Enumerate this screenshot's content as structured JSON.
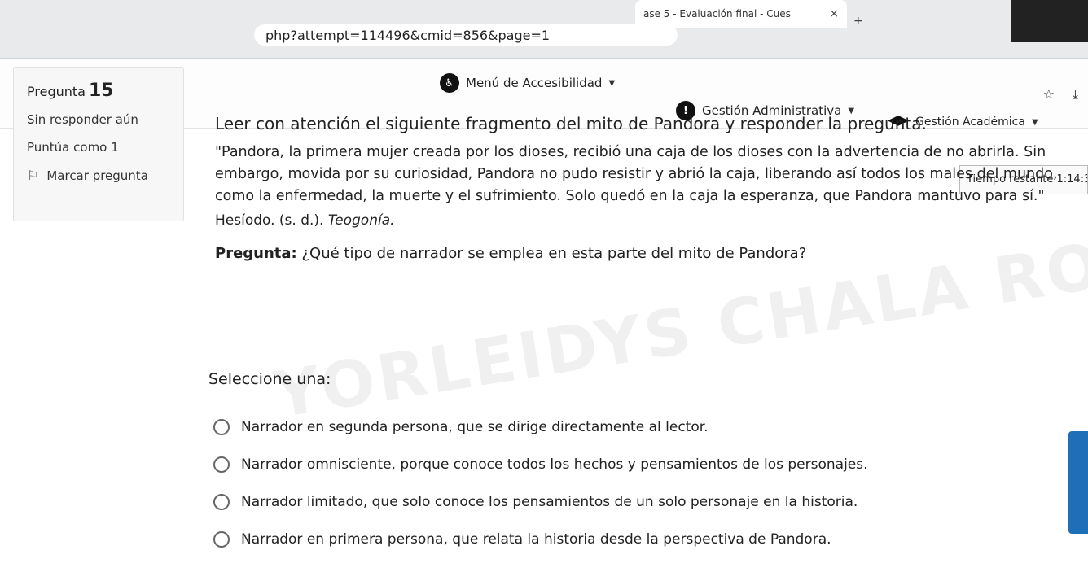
{
  "browser": {
    "tab_title": "ase 5 - Evaluación final - Cues",
    "tab_close": "×",
    "new_tab": "+",
    "url": "php?attempt=114496&cmid=856&page=1"
  },
  "navbar": {
    "accessibility_menu": "Menú de Accesibilidad",
    "admin_menu": "Gestión Administrativa",
    "academic_menu": "Gestión Académica"
  },
  "question_info": {
    "label": "Pregunta",
    "number": "15",
    "status": "Sin responder aún",
    "score": "Puntúa como 1",
    "flag_label": "Marcar pregunta"
  },
  "timer": {
    "text": "Tiempo restante 1:14:3"
  },
  "question": {
    "instruction": "Leer con atención el siguiente fragmento del mito de Pandora y responder la pregunta.",
    "passage": "\"Pandora, la primera mujer creada por los dioses, recibió una caja de los dioses con la advertencia de no abrirla. Sin embargo, movida por su curiosidad, Pandora no pudo resistir y abrió la caja, liberando así todos los males del mundo, como la enfermedad, la muerte y el sufrimiento. Solo quedó en la caja la esperanza, que Pandora mantuvo para sí.\"",
    "source_author": "Hesíodo. (s. d.). ",
    "source_title": "Teogonía.",
    "prompt_label": "Pregunta:",
    "prompt_text": " ¿Qué tipo de narrador se emplea en esta parte del mito de Pandora?",
    "select_label": "Seleccione una:",
    "answers": [
      "Narrador en segunda persona, que se dirige directamente al lector.",
      "Narrador omnisciente, porque conoce todos los hechos y pensamientos de los personajes.",
      "Narrador limitado, que solo conoce los pensamientos de un solo personaje en la historia.",
      "Narrador en primera persona, que relata la historia desde la perspectiva de Pandora."
    ]
  },
  "watermark": "YORLEIDYS CHALA ROMAN"
}
